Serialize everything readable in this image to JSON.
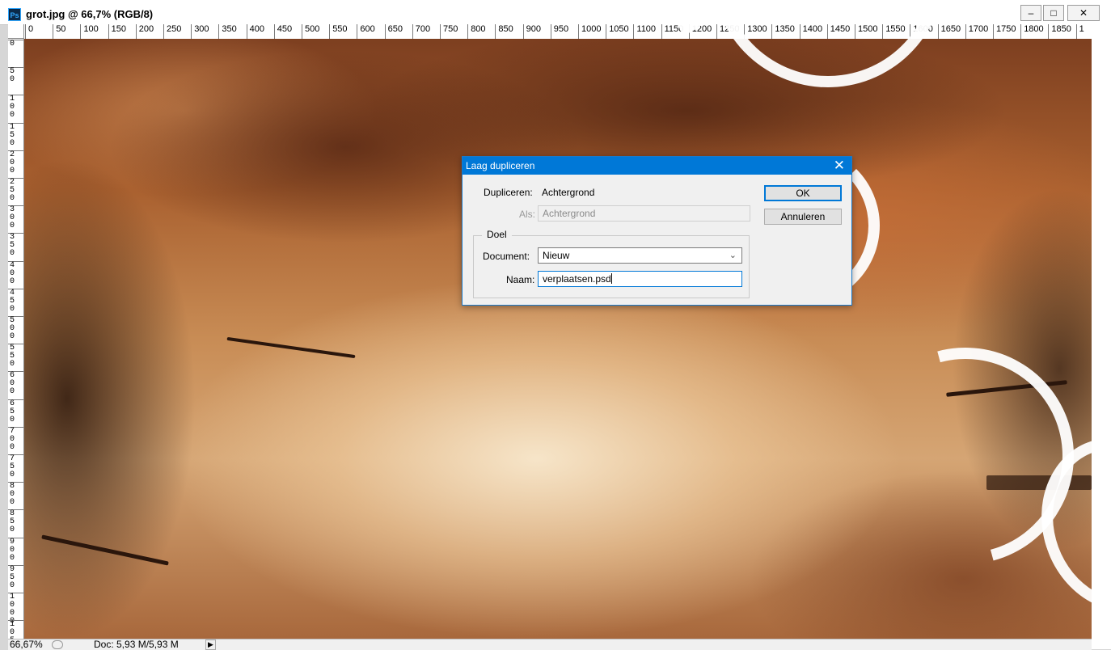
{
  "window": {
    "app_badge": "Ps",
    "title": "grot.jpg @ 66,7% (RGB/8)",
    "minimize_glyph": "–",
    "maximize_glyph": "□",
    "close_glyph": "✕"
  },
  "ruler": {
    "horizontal_labels": [
      "0",
      "50",
      "100",
      "150",
      "200",
      "250",
      "300",
      "350",
      "400",
      "450",
      "500",
      "550",
      "600",
      "650",
      "700",
      "750",
      "800",
      "850",
      "900",
      "950",
      "1000",
      "1050",
      "1100",
      "1150",
      "1200",
      "1250",
      "1300",
      "1350",
      "1400",
      "1450",
      "1500",
      "1550",
      "1600",
      "1650",
      "1700",
      "1750",
      "1800",
      "1850",
      "1"
    ],
    "vertical_labels": [
      "0",
      "5\n0",
      "1\n0\n0",
      "1\n5\n0",
      "2\n0\n0",
      "2\n5\n0",
      "3\n0\n0",
      "3\n5\n0",
      "4\n0\n0",
      "4\n5\n0",
      "5\n0\n0",
      "5\n5\n0",
      "6\n0\n0",
      "6\n5\n0",
      "7\n0\n0",
      "7\n5\n0",
      "8\n0\n0",
      "8\n5\n0",
      "9\n0\n0",
      "9\n5\n0",
      "1\n0\n0\n0",
      "1\n0\n5"
    ]
  },
  "status": {
    "zoom": "66,67%",
    "doc_info": "Doc: 5,93 M/5,93 M",
    "arrow_glyph": "▶"
  },
  "dialog": {
    "title": "Laag dupliceren",
    "close_glyph": "✕",
    "duplicate_label": "Dupliceren:",
    "duplicate_value": "Achtergrond",
    "as_label": "Als:",
    "as_value": "Achtergrond",
    "target_legend": "Doel",
    "document_label": "Document:",
    "document_value": "Nieuw",
    "name_label": "Naam:",
    "name_value": "verplaatsen.psd",
    "ok_label": "OK",
    "cancel_label": "Annuleren"
  },
  "icons": {
    "dropdown": "chevron-down-icon",
    "close": "close-icon",
    "app": "photoshop-icon"
  }
}
